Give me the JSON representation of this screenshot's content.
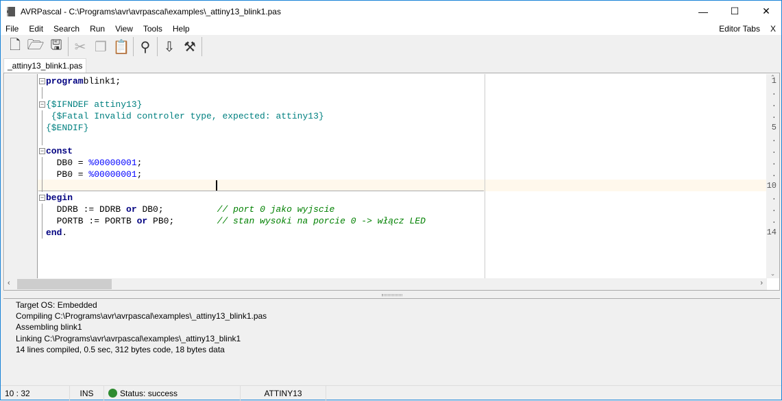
{
  "window": {
    "title": "AVRPascal - C:\\Programs\\avr\\avrpascal\\examples\\_attiny13_blink1.pas",
    "minimize": "—",
    "maximize": "☐",
    "close": "✕"
  },
  "menu": {
    "items": [
      "File",
      "Edit",
      "Search",
      "Run",
      "View",
      "Tools",
      "Help"
    ],
    "editor_tabs": "Editor Tabs",
    "close_x": "X"
  },
  "tab": {
    "label": "_attiny13_blink1.pas"
  },
  "editor": {
    "line_numbers": [
      "1",
      ".",
      ".",
      ".",
      "5",
      ".",
      ".",
      ".",
      ".",
      "10",
      ".",
      ".",
      ".",
      "14"
    ],
    "lines": [
      [
        [
          "kw",
          "program"
        ],
        [
          "",
          "blink1;"
        ]
      ],
      [],
      [
        [
          "dir",
          "{$IFNDEF attiny13}"
        ]
      ],
      [
        [
          "dir",
          " {$Fatal Invalid controler type, expected: attiny13}"
        ]
      ],
      [
        [
          "dir",
          "{$ENDIF}"
        ]
      ],
      [],
      [
        [
          "kw",
          "const"
        ]
      ],
      [
        [
          "",
          "  DB0 = "
        ],
        [
          "num",
          "%00000001"
        ],
        [
          "",
          ";"
        ]
      ],
      [
        [
          "",
          "  PB0 = "
        ],
        [
          "num",
          "%00000001"
        ],
        [
          "",
          ";"
        ]
      ],
      [],
      [
        [
          "kw",
          "begin"
        ]
      ],
      [
        [
          "",
          "  DDRB := DDRB "
        ],
        [
          "kw",
          "or"
        ],
        [
          "",
          " DB0;          "
        ],
        [
          "cmt",
          "// port 0 jako wyjscie"
        ]
      ],
      [
        [
          "",
          "  PORTB := PORTB "
        ],
        [
          "kw",
          "or"
        ],
        [
          "",
          " PB0;        "
        ],
        [
          "cmt",
          "// stan wysoki na porcie 0 -> włącz LED"
        ]
      ],
      [
        [
          "kw",
          "end"
        ],
        [
          "",
          "."
        ]
      ]
    ]
  },
  "output": {
    "lines": [
      "Target OS: Embedded",
      "Compiling C:\\Programs\\avr\\avrpascal\\examples\\_attiny13_blink1.pas",
      "Assembling blink1",
      "Linking C:\\Programs\\avr\\avrpascal\\examples\\_attiny13_blink1",
      "14 lines compiled, 0.5 sec, 312 bytes code, 18 bytes data"
    ]
  },
  "status": {
    "position": "10 :  32",
    "mode": "INS",
    "status": "Status: success",
    "status_color": "#2e8b30",
    "device": "ATTINY13"
  }
}
